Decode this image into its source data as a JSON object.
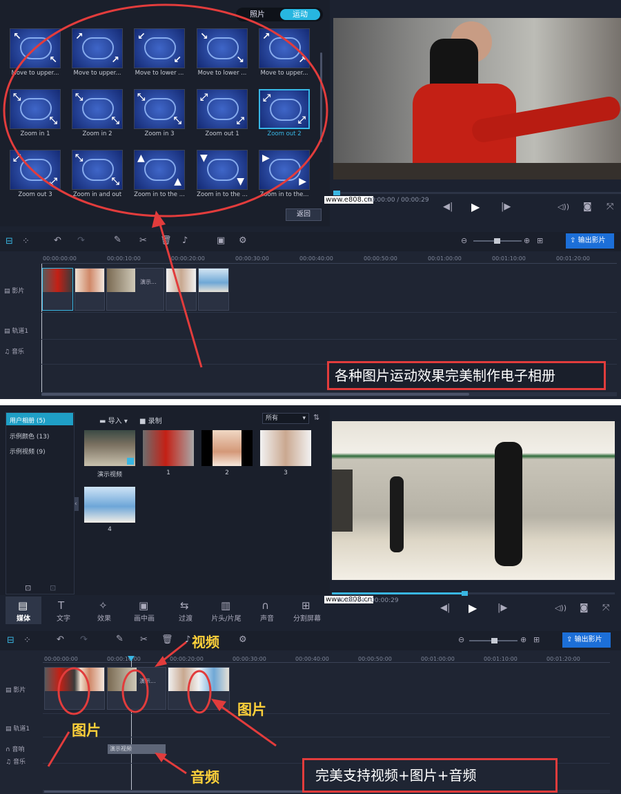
{
  "panel1": {
    "tabs": [
      "照片",
      "运动"
    ],
    "effects": [
      {
        "label": "Move to upper...",
        "icon": "arrow-up-left-icon",
        "arrows": "↖"
      },
      {
        "label": "Move to upper...",
        "icon": "arrow-up-right-icon",
        "arrows": "↗"
      },
      {
        "label": "Move to lower ...",
        "icon": "arrow-down-left-icon",
        "arrows": "↙"
      },
      {
        "label": "Move to lower ...",
        "icon": "arrow-down-right-icon",
        "arrows": "↘"
      },
      {
        "label": "Move to upper...",
        "icon": "arrow-up-right-icon",
        "arrows": "↗"
      },
      {
        "label": "Zoom in 1",
        "icon": "zoom-in-icon",
        "arrows": "⤡"
      },
      {
        "label": "Zoom in 2",
        "icon": "zoom-in-icon",
        "arrows": "⤡"
      },
      {
        "label": "Zoom in 3",
        "icon": "zoom-in-icon",
        "arrows": "⤡"
      },
      {
        "label": "Zoom out 1",
        "icon": "zoom-out-icon",
        "arrows": "⤢"
      },
      {
        "label": "Zoom out 2",
        "icon": "zoom-out-icon",
        "arrows": "⤢"
      },
      {
        "label": "Zoom out 3",
        "icon": "zoom-out-icon",
        "arrows": "⤢"
      },
      {
        "label": "Zoom in and out",
        "icon": "zoom-in-out-icon",
        "arrows": "⤡"
      },
      {
        "label": "Zoom in to the ...",
        "icon": "arrow-up-icon",
        "arrows": "▲"
      },
      {
        "label": "Zoom in to the ...",
        "icon": "arrow-down-icon",
        "arrows": "▼"
      },
      {
        "label": "Zoom in to the...",
        "icon": "arrow-right-icon",
        "arrows": "▶"
      }
    ],
    "back_button": "返回",
    "time": "00:00:00 / 00:00:29",
    "export_button": "输出影片",
    "ruler": [
      "00:00:00:00",
      "00:00:10:00",
      "00:00:20:00",
      "00:00:30:00",
      "00:00:40:00",
      "00:00:50:00",
      "00:01:00:00",
      "00:01:10:00",
      "00:01:20:00"
    ],
    "tracks": [
      "影片",
      "轨道1",
      "音乐"
    ],
    "clip_label": "演示...",
    "caption": "各种图片运动效果完美制作电子相册",
    "watermark_url": "www.e808.cn"
  },
  "panel2": {
    "albums": [
      {
        "label": "用户相册 (5)"
      },
      {
        "label": "示例颜色 (13)"
      },
      {
        "label": "示例视频 (9)"
      }
    ],
    "import_label": "导入",
    "record_label": "录制",
    "filter_value": "所有",
    "media": [
      {
        "label": "演示视频"
      },
      {
        "label": "1"
      },
      {
        "label": "2"
      },
      {
        "label": "3"
      },
      {
        "label": "4"
      }
    ],
    "time": "00:00:14 / 00:00:29",
    "mode_tabs": [
      "媒体",
      "文字",
      "效果",
      "画中画",
      "过渡",
      "片头/片尾",
      "声音",
      "分割屏幕"
    ],
    "export_button": "输出影片",
    "ruler": [
      "00:00:00:00",
      "00:00:10:00",
      "00:00:20:00",
      "00:00:30:00",
      "00:00:40:00",
      "00:00:50:00",
      "00:01:00:00",
      "00:01:10:00",
      "00:01:20:00"
    ],
    "tracks": [
      "影片",
      "轨道1",
      "音响",
      "音乐"
    ],
    "clip_label": "演示...",
    "audio_clip_label": "演示视频",
    "annotations": {
      "video": "视频",
      "image_left": "图片",
      "image_right": "图片",
      "audio": "音频"
    },
    "caption": "完美支持视频+图片+音频",
    "watermark_url": "www.e808.cn"
  }
}
